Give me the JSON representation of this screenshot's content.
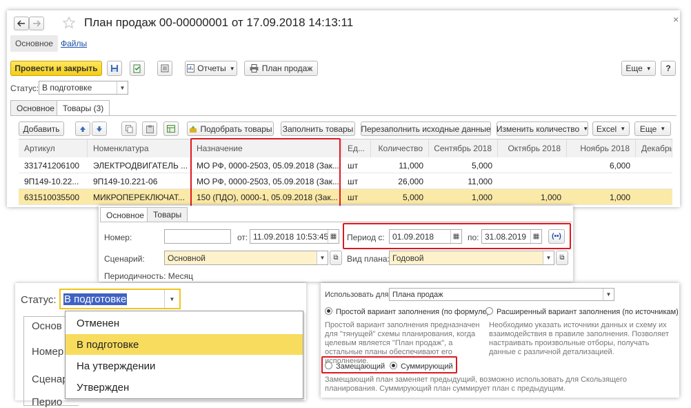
{
  "window": {
    "title": "План продаж 00-00000001 от 17.09.2018 14:13:11",
    "nav_tabs": [
      "Основное",
      "Файлы"
    ],
    "close_glyph": "×"
  },
  "toolbar": {
    "post_close": "Провести и закрыть",
    "reports": "Отчеты",
    "sales_plan": "План продаж",
    "more": "Еще",
    "help": "?"
  },
  "status": {
    "label": "Статус:",
    "value": "В подготовке"
  },
  "tabs": [
    "Основное",
    "Товары (3)"
  ],
  "table_toolbar": {
    "add": "Добавить",
    "pick": "Подобрать товары",
    "fill": "Заполнить товары",
    "refill": "Перезаполнить исходные данные",
    "change_qty": "Изменить количество",
    "excel": "Excel",
    "more": "Еще"
  },
  "table": {
    "columns": [
      "Артикул",
      "Номенклатура",
      "Назначение",
      "Ед...",
      "Количество",
      "Сентябрь 2018",
      "Октябрь 2018",
      "Ноябрь 2018",
      "Декабрь"
    ],
    "rows": [
      [
        "331741206100",
        "ЭЛЕКТРОДВИГАТЕЛЬ ...",
        "МО РФ, 0000-2503, 05.09.2018 (Зак...",
        "шт",
        "11,000",
        "5,000",
        "",
        "6,000",
        ""
      ],
      [
        "9П149-10.22...",
        "9П149-10.221-06",
        "МО РФ, 0000-2503, 05.09.2018 (Зак...",
        "шт",
        "26,000",
        "11,000",
        "",
        "",
        ""
      ],
      [
        "631510035500",
        "МИКРОПЕРЕКЛЮЧАТ...",
        "150 (ПДО), 0000-1, 05.09.2018 (Зак...",
        "шт",
        "5,000",
        "1,000",
        "1,000",
        "1,000",
        ""
      ]
    ]
  },
  "form2": {
    "tabs": [
      "Основное",
      "Товары"
    ],
    "number_label": "Номер:",
    "number_value": "",
    "from_label": "от:",
    "from_value": "11.09.2018 10:53:45",
    "period_label": "Период с:",
    "period_from": "01.09.2018",
    "period_to_label": "по:",
    "period_to": "31.08.2019",
    "scenario_label": "Сценарий:",
    "scenario_value": "Основной",
    "plan_type_label": "Вид плана:",
    "plan_type_value": "Годовой",
    "periodicity": "Периодичность: Месяц",
    "period_btn": "(••)"
  },
  "dropdown": {
    "status_label": "Статус:",
    "status_value": "В подготовке",
    "behind": [
      "Основ",
      "Номер",
      "Сценар",
      "Перио"
    ],
    "options": [
      "Отменен",
      "В подготовке",
      "На утверждении",
      "Утвержден"
    ],
    "selected_index": 1
  },
  "settings": {
    "use_for_label": "Использовать для:",
    "use_for_value": "Плана продаж",
    "simple": "Простой вариант заполнения (по формуле)",
    "extended": "Расширенный вариант заполнения (по источникам)",
    "simple_hint": "Простой вариант заполнения предназначен для \"тянущей\" схемы планирования, когда целевым является \"План продаж\", а остальные планы обеспечивают его исполнение.",
    "extended_hint": "Необходимо указать источники данных и схему их взаимодействия в правиле заполнения. Позволяет настраивать произвольные отборы, получать данные с различной детализацией.",
    "replacing": "Замещающий",
    "summing": "Суммирующий",
    "mode_hint": "Замещающий план заменяет предыдущий, возможно использовать для Скользящего планирования. Суммирующий план суммирует план с предыдущим."
  },
  "colors": {
    "accent_yellow": "#f5cd18",
    "highlight_red": "#e0161e",
    "selected_row": "#fbe9a7",
    "link_blue": "#1a4fa8"
  }
}
